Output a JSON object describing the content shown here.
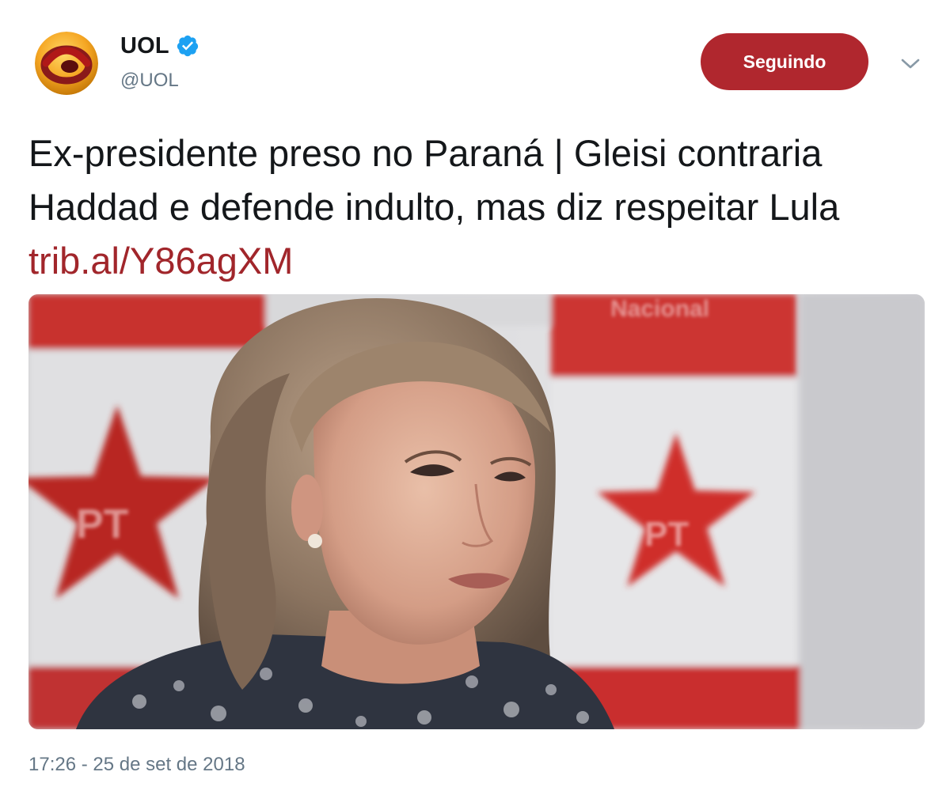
{
  "author": {
    "display_name": "UOL",
    "handle": "@UOL",
    "verified": true,
    "avatar_icon": "uol-logo-icon"
  },
  "actions": {
    "follow_label": "Seguindo",
    "menu_icon": "chevron-down-icon"
  },
  "tweet": {
    "text": "Ex-presidente preso no Paraná | Gleisi contraria Haddad e defende indulto, mas diz respeitar Lula",
    "link": "trib.al/Y86agXM",
    "timestamp": "17:26 - 25 de set de 2018"
  },
  "media": {
    "star_logo_text": "PT",
    "banner_text": "Nacional"
  },
  "colors": {
    "follow_button": "#b0272e",
    "link": "#a1262b",
    "verified": "#1da1f2",
    "secondary_text": "#657786"
  }
}
